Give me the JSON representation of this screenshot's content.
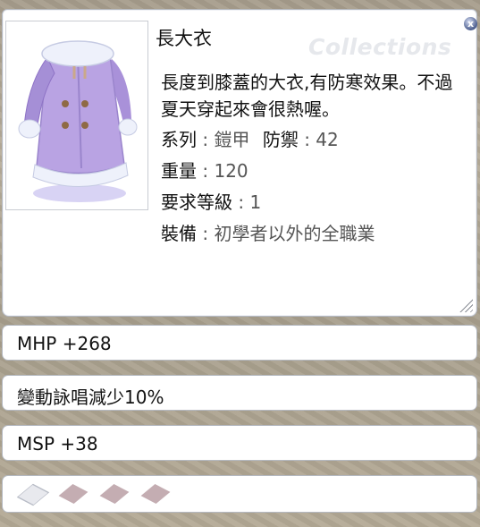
{
  "window": {
    "title": "長大衣",
    "watermark": "Collections",
    "close_label": "x"
  },
  "item": {
    "description": "長度到膝蓋的大衣,有防寒效果。不過夏天穿起來會很熱喔。",
    "props": [
      {
        "label": "系列",
        "value": "鎧甲",
        "extra_label": "防禦",
        "extra_value": "42"
      },
      {
        "label": "重量",
        "value": "120"
      },
      {
        "label": "要求等級",
        "value": "1"
      },
      {
        "label": "裝備",
        "value": "初學者以外的全職業"
      }
    ]
  },
  "stats": [
    "MHP +268",
    "變動詠唱減少10%",
    "MSP +38"
  ],
  "colors": {
    "coat_main": "#b9a3e3",
    "coat_shadow": "#8e73c6",
    "fur": "#eef1fb",
    "button": "#8f6a45",
    "slot_empty": "#c4adb2",
    "slot_first": "#e8e9ee"
  },
  "icons": {
    "close": "close-icon",
    "resize": "resize-grip-icon",
    "slot": "card-slot-icon"
  }
}
